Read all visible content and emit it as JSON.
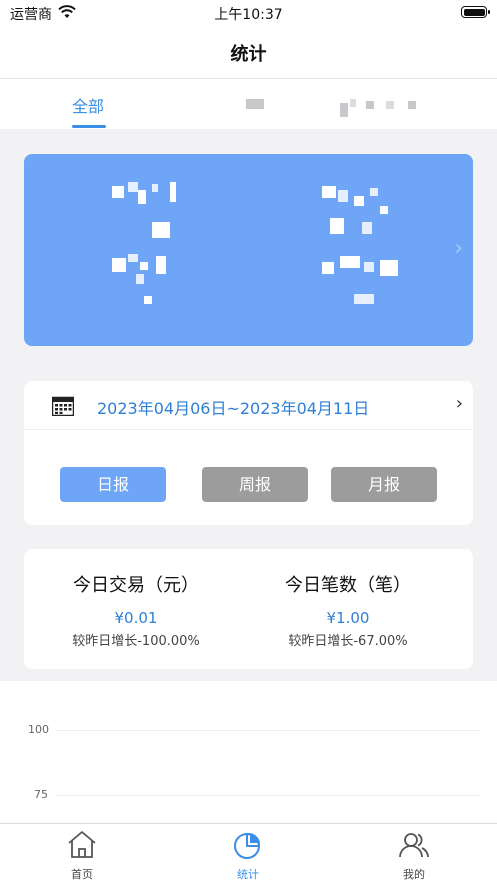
{
  "status_bar": {
    "carrier": "运营商",
    "time": "上午10:37"
  },
  "nav": {
    "title": "统计"
  },
  "tabs": {
    "active_label": "全部"
  },
  "date_range": {
    "text": "2023年04月06日~2023年04月11日"
  },
  "period_buttons": {
    "day": "日报",
    "week": "周报",
    "month": "月报"
  },
  "stats": {
    "transactions": {
      "title": "今日交易（元）",
      "value": "¥0.01",
      "change": "较昨日增长-100.00%"
    },
    "count": {
      "title": "今日笔数（笔）",
      "value": "¥1.00",
      "change": "较昨日增长-67.00%"
    }
  },
  "chart_data": {
    "type": "line",
    "ytick_labels": [
      "100",
      "75"
    ],
    "series": []
  },
  "bottom_tabs": [
    {
      "label": "首页",
      "icon": "home-icon"
    },
    {
      "label": "统计",
      "icon": "stats-pie-icon",
      "active": true
    },
    {
      "label": "我的",
      "icon": "user-icon"
    }
  ],
  "colors": {
    "accent": "#3a8ee6",
    "card_blue": "#6ea5f7",
    "button_inactive": "#9c9c9c"
  }
}
